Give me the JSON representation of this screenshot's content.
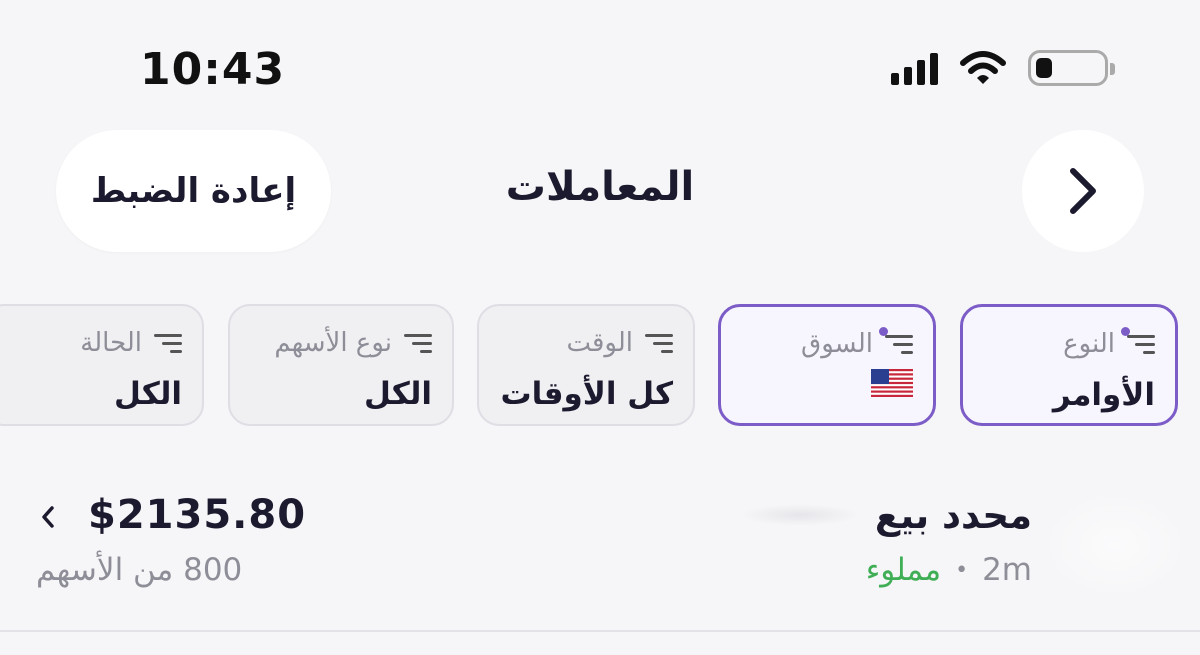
{
  "status_bar": {
    "time": "10:43"
  },
  "header": {
    "reset_label": "إعادة الضبط",
    "title": "المعاملات"
  },
  "filters": [
    {
      "label": "النوع",
      "value": "الأوامر",
      "active": true
    },
    {
      "label": "السوق",
      "value_icon": "us-flag-icon",
      "active": true
    },
    {
      "label": "الوقت",
      "value": "كل الأوقات",
      "active": false
    },
    {
      "label": "نوع الأسهم",
      "value": "الكل",
      "active": false
    },
    {
      "label": "الحالة",
      "value": "الكل",
      "active": false
    }
  ],
  "transaction": {
    "title": "محدد بيع",
    "time": "2m",
    "status": "مملوء",
    "amount": "$2135.80",
    "shares": "800 من الأسهم"
  },
  "colors": {
    "accent": "#7c5cc7",
    "success": "#3fae55",
    "muted": "#8e8e98"
  }
}
